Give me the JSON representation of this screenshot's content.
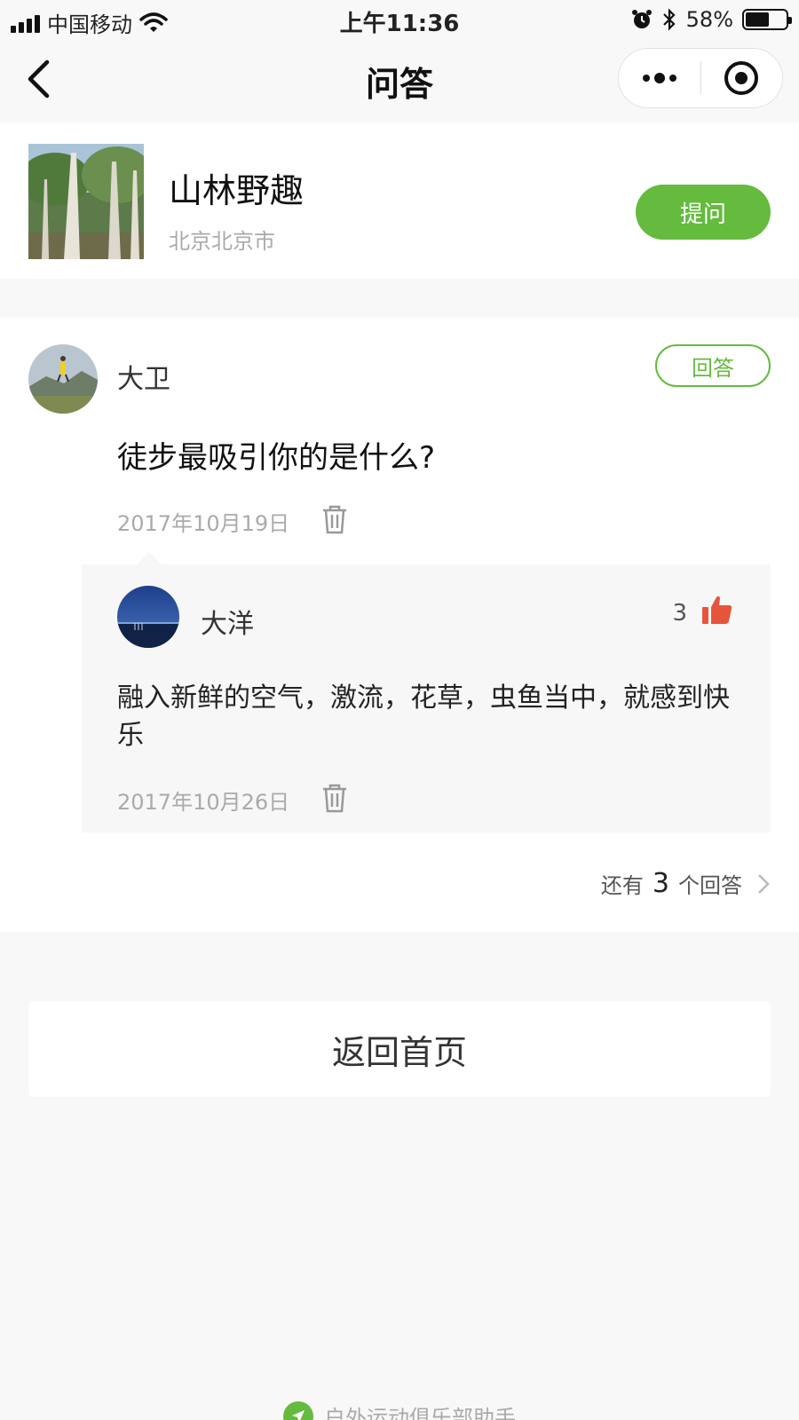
{
  "status_bar": {
    "carrier": "中国移动",
    "time": "上午11:36",
    "battery_pct": "58%",
    "battery_level": 0.58,
    "icons": [
      "signal-icon",
      "wifi-icon",
      "alarm-icon",
      "bluetooth-icon",
      "battery-icon"
    ]
  },
  "nav": {
    "title": "问答",
    "back_icon": "chevron-left-icon",
    "menu_icon": "more-dots-icon",
    "close_icon": "target-icon"
  },
  "club": {
    "name": "山林野趣",
    "city": "北京北京市",
    "ask_label": "提问"
  },
  "question": {
    "author": "大卫",
    "answer_label": "回答",
    "text": "徒步最吸引你的是什么?",
    "date": "2017年10月19日",
    "answer": {
      "author": "大洋",
      "likes": "3",
      "text": " 融入新鲜的空气，激流，花草，虫鱼当中，就感到快乐",
      "date": "2017年10月26日"
    },
    "more": {
      "prefix": "还有",
      "count": "3",
      "suffix": "个回答"
    }
  },
  "home_label": "返回首页",
  "footer_label": "户外运动俱乐部助手",
  "colors": {
    "accent": "#64bb3e",
    "like": "#e5553c",
    "background": "#f8f8f8"
  }
}
